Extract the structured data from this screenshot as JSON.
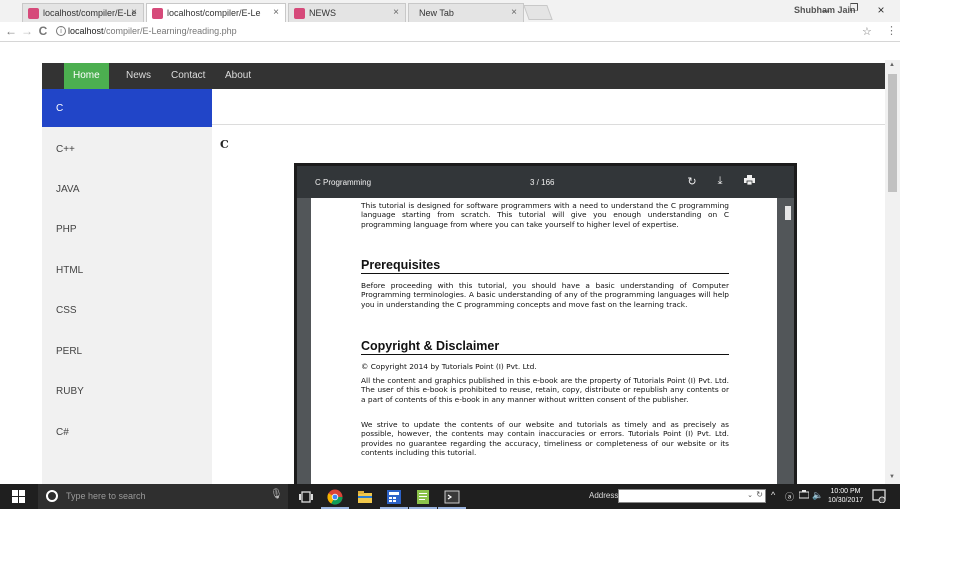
{
  "browser": {
    "tabs": [
      {
        "title": "localhost/compiler/E-Le",
        "active": false
      },
      {
        "title": "localhost/compiler/E-Le",
        "active": true
      },
      {
        "title": "NEWS",
        "active": false
      },
      {
        "title": "New Tab",
        "active": false
      }
    ],
    "tab_close": "×",
    "profile": "Shubham Jain",
    "window_controls": {
      "minimize": "–",
      "maximize": "❐",
      "close": "×"
    },
    "address": {
      "host": "localhost",
      "path": "/compiler/E-Learning/reading.php"
    },
    "nav": {
      "back": "←",
      "forward": "→",
      "reload": "C"
    }
  },
  "site": {
    "nav_items": [
      "Home",
      "News",
      "Contact",
      "About"
    ],
    "active_nav": "Home",
    "sidebar": [
      "C",
      "C++",
      "JAVA",
      "PHP",
      "HTML",
      "CSS",
      "PERL",
      "RUBY",
      "C#"
    ],
    "active_sidebar": "C",
    "main_title": "C"
  },
  "pdf": {
    "title": "C Programming",
    "page_indicator": "3 / 166",
    "icons": [
      "rotate-icon",
      "download-icon",
      "print-icon"
    ],
    "content": {
      "intro": "This tutorial is designed for software programmers with a need to understand the C programming language starting from scratch. This tutorial will give you enough understanding on C programming language from where you can take yourself to higher level of expertise.",
      "heading1": "Prerequisites",
      "prereq": "Before proceeding with this tutorial, you should have a basic understanding of Computer Programming terminologies. A basic understanding of any of the programming languages will help you in understanding the C programming concepts and move fast on the learning track.",
      "heading2": "Copyright & Disclaimer",
      "copyright_line": "© Copyright 2014 by Tutorials Point (I) Pvt. Ltd.",
      "para1": "All the content and graphics published in this e-book are the property of Tutorials Point (I) Pvt. Ltd.  The user of this e-book is prohibited to reuse, retain, copy, distribute or republish any contents or a part of contents of this e-book in any manner without written consent of the publisher.",
      "para2": "We strive to update the contents of our website and tutorials as timely and as precisely as possible, however, the contents may contain inaccuracies or errors. Tutorials Point (I) Pvt. Ltd. provides no guarantee regarding the accuracy, timeliness or completeness of our website or its contents including this tutorial."
    }
  },
  "taskbar": {
    "search_placeholder": "Type here to search",
    "address_label": "Address",
    "time": "10:00 PM",
    "date": "10/30/2017"
  }
}
